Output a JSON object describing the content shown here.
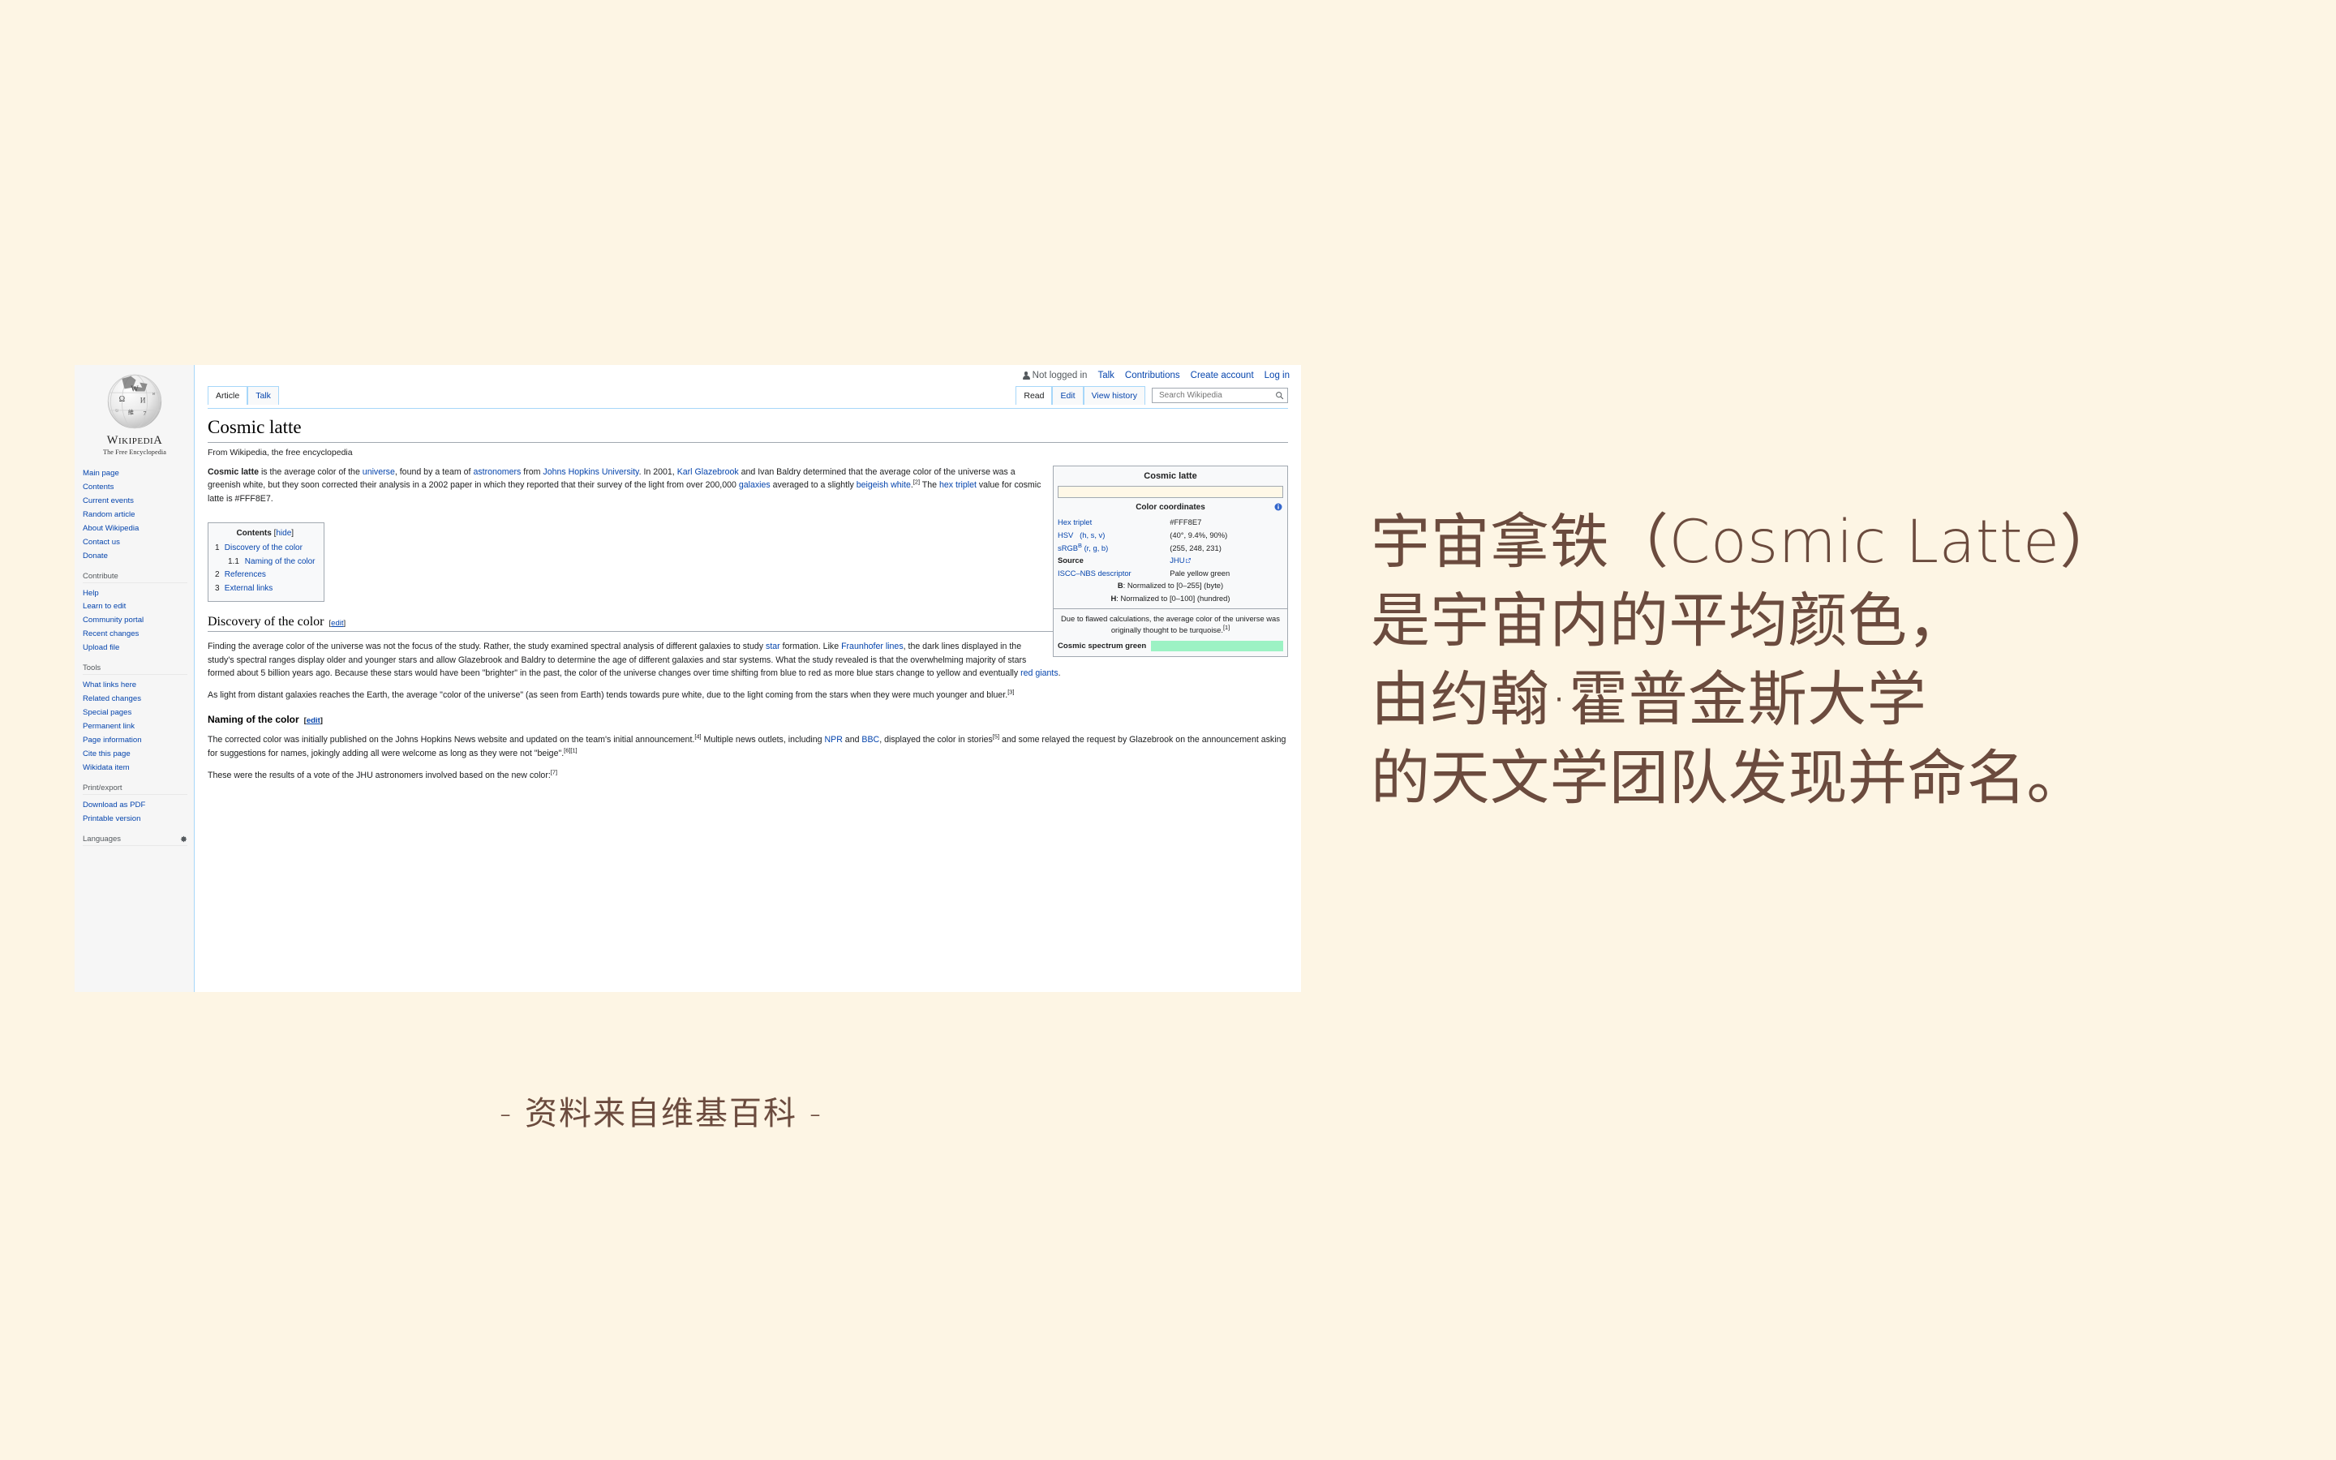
{
  "background_color": "#fdf5e4",
  "caption": {
    "lines": [
      "宇宙拿铁（Cosmic Latte）",
      "是宇宙内的平均颜色，",
      "由约翰·霍普金斯大学",
      "的天文学团队发现并命名。"
    ],
    "footer": "- 资料来自维基百科 -",
    "text_color": "#6b4b3e"
  },
  "wiki": {
    "personal_bar": {
      "not_logged_in": "Not logged in",
      "links": [
        "Talk",
        "Contributions",
        "Create account",
        "Log in"
      ]
    },
    "logo": {
      "wordmark_w": "W",
      "wordmark_rest": "IKIPEDI",
      "wordmark_a": "A",
      "tagline": "The Free Encyclopedia"
    },
    "sidebar": {
      "main_links": [
        "Main page",
        "Contents",
        "Current events",
        "Random article",
        "About Wikipedia",
        "Contact us",
        "Donate"
      ],
      "contribute_heading": "Contribute",
      "contribute_links": [
        "Help",
        "Learn to edit",
        "Community portal",
        "Recent changes",
        "Upload file"
      ],
      "tools_heading": "Tools",
      "tools_links": [
        "What links here",
        "Related changes",
        "Special pages",
        "Permanent link",
        "Page information",
        "Cite this page",
        "Wikidata item"
      ],
      "print_heading": "Print/export",
      "print_links": [
        "Download as PDF",
        "Printable version"
      ],
      "languages_heading": "Languages"
    },
    "tabs_left": [
      {
        "label": "Article",
        "selected": true
      },
      {
        "label": "Talk",
        "selected": false
      }
    ],
    "tabs_right": [
      {
        "label": "Read",
        "selected": true
      },
      {
        "label": "Edit",
        "selected": false
      },
      {
        "label": "View history",
        "selected": false
      }
    ],
    "search": {
      "placeholder": "Search Wikipedia",
      "value": ""
    },
    "article": {
      "title": "Cosmic latte",
      "site_sub": "From Wikipedia, the free encyclopedia",
      "lead": {
        "bold_term": "Cosmic latte",
        "text_1": " is the average color of the ",
        "link_universe": "universe",
        "text_2": ", found by a team of ",
        "link_astronomers": "astronomers",
        "text_3": " from ",
        "link_jhu": "Johns Hopkins University",
        "text_4": ". In 2001, ",
        "link_karl": "Karl Glazebrook",
        "text_5": " and Ivan Baldry determined that the average color of the universe was a greenish white, but they soon corrected their analysis in a 2002 paper in which they reported that their survey of the light from over 200,000 ",
        "link_galaxies": "galaxies",
        "text_6": " averaged to a slightly ",
        "link_beigeish": "beigeish white",
        "text_7": ".",
        "ref_2": "[2]",
        "text_8": " The ",
        "link_hex": "hex triplet",
        "text_9": " value for cosmic latte is #FFF8E7."
      },
      "toc": {
        "heading": "Contents",
        "hide_open": "[",
        "hide_label": "hide",
        "hide_close": "]",
        "items": [
          {
            "num": "1",
            "label": "Discovery of the color"
          },
          {
            "num": "1.1",
            "label": "Naming of the color",
            "sub": true
          },
          {
            "num": "2",
            "label": "References"
          },
          {
            "num": "3",
            "label": "External links"
          }
        ]
      },
      "section_1": {
        "heading": "Discovery of the color",
        "edit_open": "[",
        "edit_label": "edit",
        "edit_close": "]",
        "p1_a": "Finding the average color of the universe was not the focus of the study. Rather, the study examined spectral analysis of different galaxies to study ",
        "p1_link_star": "star",
        "p1_b": " formation. Like ",
        "p1_link_fraunhofer": "Fraunhofer lines",
        "p1_c": ", the dark lines displayed in the study's spectral ranges display older and younger stars and allow Glazebrook and Baldry to determine the age of different galaxies and star systems. What the study revealed is that the overwhelming majority of stars formed about 5 billion years ago. Because these stars would have been \"brighter\" in the past, the color of the universe changes over time shifting from blue to red as more blue stars change to yellow and eventually ",
        "p1_link_redgiants": "red giants",
        "p1_d": ".",
        "p2_a": "As light from distant galaxies reaches the Earth, the average \"color of the universe\" (as seen from Earth) tends towards pure white, due to the light coming from the stars when they were much younger and bluer.",
        "p2_ref": "[3]"
      },
      "section_1_1": {
        "heading": "Naming of the color",
        "edit_open": "[",
        "edit_label": "edit",
        "edit_close": "]",
        "p1_a": "The corrected color was initially published on the Johns Hopkins News website and updated on the team's initial announcement.",
        "p1_ref4": "[4]",
        "p1_b": " Multiple news outlets, including ",
        "p1_link_npr": "NPR",
        "p1_c": " and ",
        "p1_link_bbc": "BBC",
        "p1_d": ", displayed the color in stories",
        "p1_ref5": "[5]",
        "p1_e": " and some relayed the request by Glazebrook on the announcement asking for suggestions for names, jokingly adding all were welcome as long as they were not \"beige\".",
        "p1_ref61": "[6][1]",
        "p2_a": "These were the results of a vote of the JHU astronomers involved based on the new color:",
        "p2_ref": "[7]"
      }
    },
    "infobox": {
      "title": "Cosmic latte",
      "swatch_color": "#fff8e7",
      "sub_heading": "Color coordinates",
      "rows": [
        {
          "label": "Hex triplet",
          "sublabel": "",
          "value": "#FFF8E7",
          "link": false
        },
        {
          "label": "HSV",
          "sublabel": "(h, s, v)",
          "value": "(40°, 9.4%, 90%)",
          "link": false
        },
        {
          "label": "sRGB",
          "sup": "B",
          "sublabel": "(r, g, b)",
          "value": "(255, 248, 231)",
          "link": false
        },
        {
          "label": "Source",
          "sublabel": "",
          "value": "JHU",
          "link": true
        },
        {
          "label": "ISCC–NBS descriptor",
          "sublabel": "",
          "value": "Pale yellow green",
          "link": false
        }
      ],
      "note_b_key": "B",
      "note_b": ": Normalized to [0–255] (byte)",
      "note_h_key": "H",
      "note_h": ": Normalized to [0–100] (hundred)",
      "flawed_text": "Due to flawed calculations, the average color of the universe was originally thought to be turquoise.",
      "flawed_ref": "[1]",
      "green_label": "Cosmic spectrum green",
      "green_color": "#9cf2c4"
    }
  }
}
